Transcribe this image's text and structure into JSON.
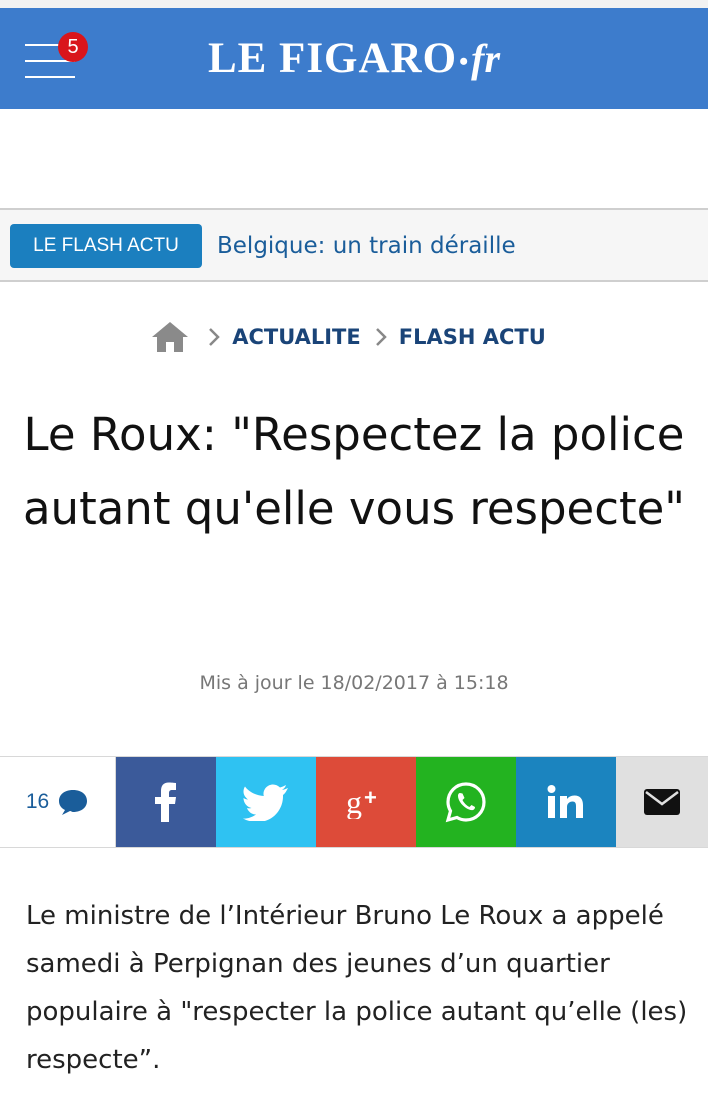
{
  "header": {
    "notification_count": "5",
    "logo_main": "LE FIGARO",
    "logo_dot": "•",
    "logo_suffix": "fr",
    "bg_color": "#3d7ccc"
  },
  "flash": {
    "tag_label": "LE FLASH  ACTU",
    "headline": "Belgique: un train déraille",
    "tag_color": "#1b7fbf"
  },
  "breadcrumb": {
    "home_icon": "home-icon",
    "items": [
      "ACTUALITE",
      "FLASH ACTU"
    ]
  },
  "article": {
    "title": "Le Roux: \"Respectez la police autant qu'elle vous respecte\"",
    "updated": "Mis à jour le 18/02/2017 à 15:18",
    "lead": "Le ministre de l’Intérieur Bruno Le Roux a appelé samedi à Perpignan des jeunes d’un quartier populaire à \"respecter la police autant qu’elle (les) respecte”."
  },
  "share": {
    "comment_count": "16",
    "buttons": [
      {
        "name": "facebook",
        "icon": "facebook-icon",
        "color": "#3b5a9a"
      },
      {
        "name": "twitter",
        "icon": "twitter-icon",
        "color": "#2fc2f2"
      },
      {
        "name": "google-plus",
        "icon": "google-plus-icon",
        "color": "#dd4b39"
      },
      {
        "name": "whatsapp",
        "icon": "whatsapp-icon",
        "color": "#23b320"
      },
      {
        "name": "linkedin",
        "icon": "linkedin-icon",
        "color": "#1b84bf"
      },
      {
        "name": "email",
        "icon": "mail-icon",
        "color": "#e0e0e0"
      }
    ]
  }
}
